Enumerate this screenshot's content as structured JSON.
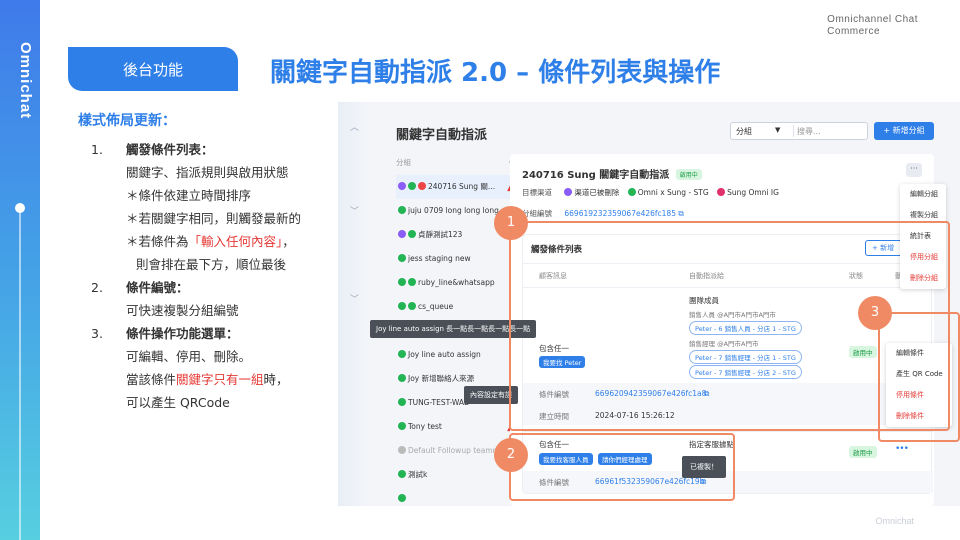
{
  "slide": {
    "brand_vertical": "Omnichat",
    "corner_lines": [
      "Omnichannel Chat",
      "Commerce"
    ],
    "section_pill": "後台功能",
    "title": "關鍵字自動指派 2.0 – 條件列表與操作",
    "footer": "Omnichat"
  },
  "notes": {
    "heading": "樣式佈局更新：",
    "items": {
      "n1": "1.",
      "t1": "觸發條件列表：",
      "l1a": "關鍵字、指派規則與啟用狀態",
      "l1b": "＊條件依建立時間排序",
      "l1c": "＊若關鍵字相同，則觸發最新的",
      "l1d_pre": "＊若條件為",
      "l1d_red": "「輸入任何內容」",
      "l1d_post": "，",
      "l1e": "則會排在最下方，順位最後",
      "n2": "2.",
      "t2": "條件編號：",
      "l2a": "可快速複製分組編號",
      "n3": "3.",
      "t3": "條件操作功能選單：",
      "l3a": "可編輯、停用、刪除。",
      "l3b_pre": "當該條件",
      "l3b_red": "關鍵字只有一組",
      "l3b_post": "時，",
      "l3c": "可以產生 QRCode"
    }
  },
  "screenshot": {
    "page_title": "關鍵字自動指派",
    "filter_select": "分組",
    "search_placeholder": "搜尋...",
    "add_group_button": "+ 新增分組",
    "group_list_header": "分組",
    "group_add": "+",
    "groups": [
      {
        "name": "240716 Sung 關...",
        "icons": [
          "m",
          "g",
          "r"
        ],
        "warn": true
      },
      {
        "name": "juju 0709 long long long ...",
        "icons": [
          "g"
        ]
      },
      {
        "name": "貞靜測試123",
        "icons": [
          "m",
          "g"
        ]
      },
      {
        "name": "jess staging new",
        "icons": [
          "g"
        ]
      },
      {
        "name": "ruby_line&whatsapp",
        "icons": [
          "g",
          "g"
        ]
      },
      {
        "name": "cs_queue",
        "icons": [
          "g",
          "g"
        ]
      },
      {
        "name": "",
        "icons": []
      },
      {
        "name": "Joy line auto assign",
        "icons": [
          "g"
        ]
      },
      {
        "name": "Joy 新增聯絡人來源",
        "icons": [
          "g"
        ]
      },
      {
        "name": "TUNG-TEST-WAB",
        "icons": [
          "g"
        ]
      },
      {
        "name": "Tony test",
        "icons": [
          "g"
        ],
        "warn": true
      },
      {
        "name": "Default Followup teamm...",
        "icons": [
          "gr"
        ],
        "grey": true
      },
      {
        "name": "測試k",
        "icons": [
          "g"
        ]
      },
      {
        "name": "",
        "icons": [
          "g"
        ]
      }
    ],
    "detail": {
      "title": "240716 Sung 關鍵字自動指派",
      "status": "啟用中",
      "more": "···",
      "channels_label": "目標渠道",
      "channels": [
        "渠道已被刪除",
        "Omni x Sung - STG",
        "Sung Omni IG"
      ],
      "group_id_label": "分組編號",
      "group_id": "669619232359067e426fc185",
      "conditions_title": "觸發條件列表",
      "add_condition": "+ 新增",
      "col_keyword": "顧客訊息",
      "col_assign": "自動指派給",
      "col_status": "狀態",
      "col_action": "動",
      "cond1": {
        "match": "包含任一",
        "tag": "我要找 Peter",
        "members_label": "團隊成員",
        "line1": "銷售人員 @A門市A門市A門市",
        "pill1": "Peter - 6 銷售人員 - 分店 1 - STG",
        "line2": "銷售經理 @A門市A門市",
        "pill2": "Peter - 7 銷售經理 - 分店 1 - STG",
        "pill3": "Peter - 7 銷售經理 - 分店 2 - STG",
        "status": "啟用中",
        "id_label": "條件編號",
        "id": "669620942359067e426fc1a8",
        "created_label": "建立時間",
        "created": "2024-07-16 15:26:12"
      },
      "cond2": {
        "match": "包含任一",
        "assign_label": "指定客服據點",
        "tag1": "我要找客服人員",
        "tag2": "請你們經理處理",
        "status": "啟用中",
        "id_label": "條件編號",
        "id": "66961f532359067e426fc19b"
      }
    },
    "group_menu": [
      "編輯分組",
      "複製分組",
      "統計表",
      "停用分組",
      "刪除分組"
    ],
    "condition_menu": [
      "編輯條件",
      "產生 QR Code",
      "停用條件",
      "刪除條件"
    ],
    "tooltip_long": "Joy line auto assign 長一點長一點長一點長一點",
    "tooltip_content": "內容設定有誤",
    "copied_toast": "已複製！",
    "markers": [
      "1",
      "2",
      "3"
    ]
  }
}
